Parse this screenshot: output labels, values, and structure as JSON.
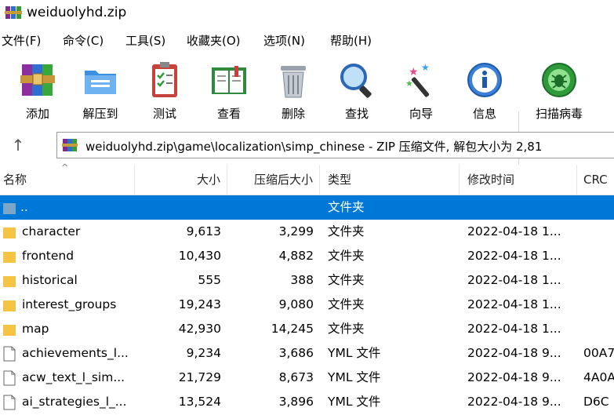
{
  "window": {
    "title": "weiduolyhd.zip"
  },
  "menu": [
    "文件(F)",
    "命令(C)",
    "工具(S)",
    "收藏夹(O)",
    "选项(N)",
    "帮助(H)"
  ],
  "toolbar": [
    {
      "label": "添加",
      "icon": "add-archive-icon"
    },
    {
      "label": "解压到",
      "icon": "extract-folder-icon"
    },
    {
      "label": "测试",
      "icon": "test-clipboard-icon"
    },
    {
      "label": "查看",
      "icon": "view-book-icon"
    },
    {
      "label": "删除",
      "icon": "trash-icon"
    },
    {
      "label": "查找",
      "icon": "magnifier-icon"
    },
    {
      "label": "向导",
      "icon": "wizard-wand-icon"
    },
    {
      "label": "信息",
      "icon": "info-icon"
    },
    {
      "label": "扫描病毒",
      "icon": "virus-scan-icon"
    }
  ],
  "address": {
    "path": "weiduolyhd.zip\\game\\localization\\simp_chinese - ZIP 压缩文件, 解包大小为 2,81"
  },
  "columns": {
    "name": "名称",
    "size": "大小",
    "packed": "压缩后大小",
    "type": "类型",
    "modified": "修改时间",
    "crc": "CRC"
  },
  "rows": [
    {
      "name": "..",
      "size": "",
      "packed": "",
      "type": "文件夹",
      "modified": "",
      "crc": "",
      "kind": "parent",
      "selected": true
    },
    {
      "name": "character",
      "size": "9,613",
      "packed": "3,299",
      "type": "文件夹",
      "modified": "2022-04-18 1...",
      "crc": "",
      "kind": "folder"
    },
    {
      "name": "frontend",
      "size": "10,430",
      "packed": "4,882",
      "type": "文件夹",
      "modified": "2022-04-18 1...",
      "crc": "",
      "kind": "folder"
    },
    {
      "name": "historical",
      "size": "555",
      "packed": "388",
      "type": "文件夹",
      "modified": "2022-04-18 1...",
      "crc": "",
      "kind": "folder"
    },
    {
      "name": "interest_groups",
      "size": "19,243",
      "packed": "9,080",
      "type": "文件夹",
      "modified": "2022-04-18 1...",
      "crc": "",
      "kind": "folder"
    },
    {
      "name": "map",
      "size": "42,930",
      "packed": "14,245",
      "type": "文件夹",
      "modified": "2022-04-18 1...",
      "crc": "",
      "kind": "folder"
    },
    {
      "name": "achievements_l...",
      "size": "9,234",
      "packed": "3,686",
      "type": "YML 文件",
      "modified": "2022-04-18 9...",
      "crc": "00A7",
      "kind": "file"
    },
    {
      "name": "acw_text_l_sim...",
      "size": "21,729",
      "packed": "8,673",
      "type": "YML 文件",
      "modified": "2022-04-18 9...",
      "crc": "4A0A",
      "kind": "file"
    },
    {
      "name": "ai_strategies_l_...",
      "size": "13,524",
      "packed": "3,896",
      "type": "YML 文件",
      "modified": "2022-04-18 9...",
      "crc": "D6C",
      "kind": "file"
    }
  ],
  "colors": {
    "selection": "#0078d7",
    "folder": "#f6c445"
  }
}
